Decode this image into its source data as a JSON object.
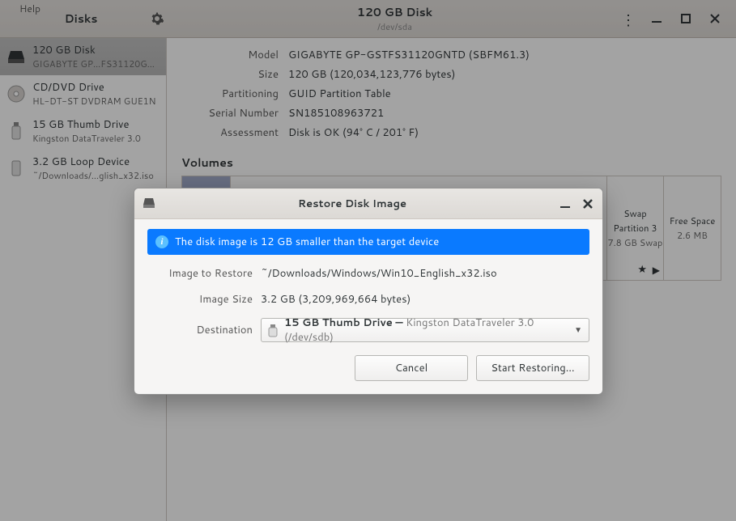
{
  "help_menu": "Help",
  "titlebar": {
    "sidebar_title": "Disks",
    "main_title": "120 GB Disk",
    "main_sub": "/dev/sda"
  },
  "devices": [
    {
      "name": "120 GB Disk",
      "desc": "GIGABYTE GP…FS31120GNTD"
    },
    {
      "name": "CD/DVD Drive",
      "desc": "HL-DT-ST DVDRAM GUE1N"
    },
    {
      "name": "15 GB Thumb Drive",
      "desc": "Kingston DataTraveler 3.0"
    },
    {
      "name": "3.2 GB Loop Device",
      "desc": "~/Downloads/…glish_x32.iso"
    }
  ],
  "info": {
    "model_lbl": "Model",
    "model_val": "GIGABYTE GP-GSTFS31120GNTD (SBFM61.3)",
    "size_lbl": "Size",
    "size_val": "120 GB (120,034,123,776 bytes)",
    "part_lbl": "Partitioning",
    "part_val": "GUID Partition Table",
    "serial_lbl": "Serial Number",
    "serial_val": "SN185108963721",
    "assess_lbl": "Assessment",
    "assess_val": "Disk is OK (94° C / 201° F)"
  },
  "volumes_header": "Volumes",
  "volumes": {
    "p3": {
      "name": "Swap",
      "line2": "Partition 3",
      "line3": "7.8 GB Swap"
    },
    "fs": {
      "name": "Free Space",
      "line2": "2.6 MB"
    }
  },
  "dialog": {
    "title": "Restore Disk Image",
    "banner": "The disk image is 12 GB smaller than the target device",
    "image_lbl": "Image to Restore",
    "image_val": "~/Downloads/Windows/Win10_English_x32.iso",
    "size_lbl": "Image Size",
    "size_val": "3.2 GB (3,209,969,664 bytes)",
    "dest_lbl": "Destination",
    "dest_name": "15 GB Thumb Drive — ",
    "dest_sub": "Kingston DataTraveler 3.0 (/dev/sdb)",
    "cancel": "Cancel",
    "start": "Start Restoring…"
  }
}
